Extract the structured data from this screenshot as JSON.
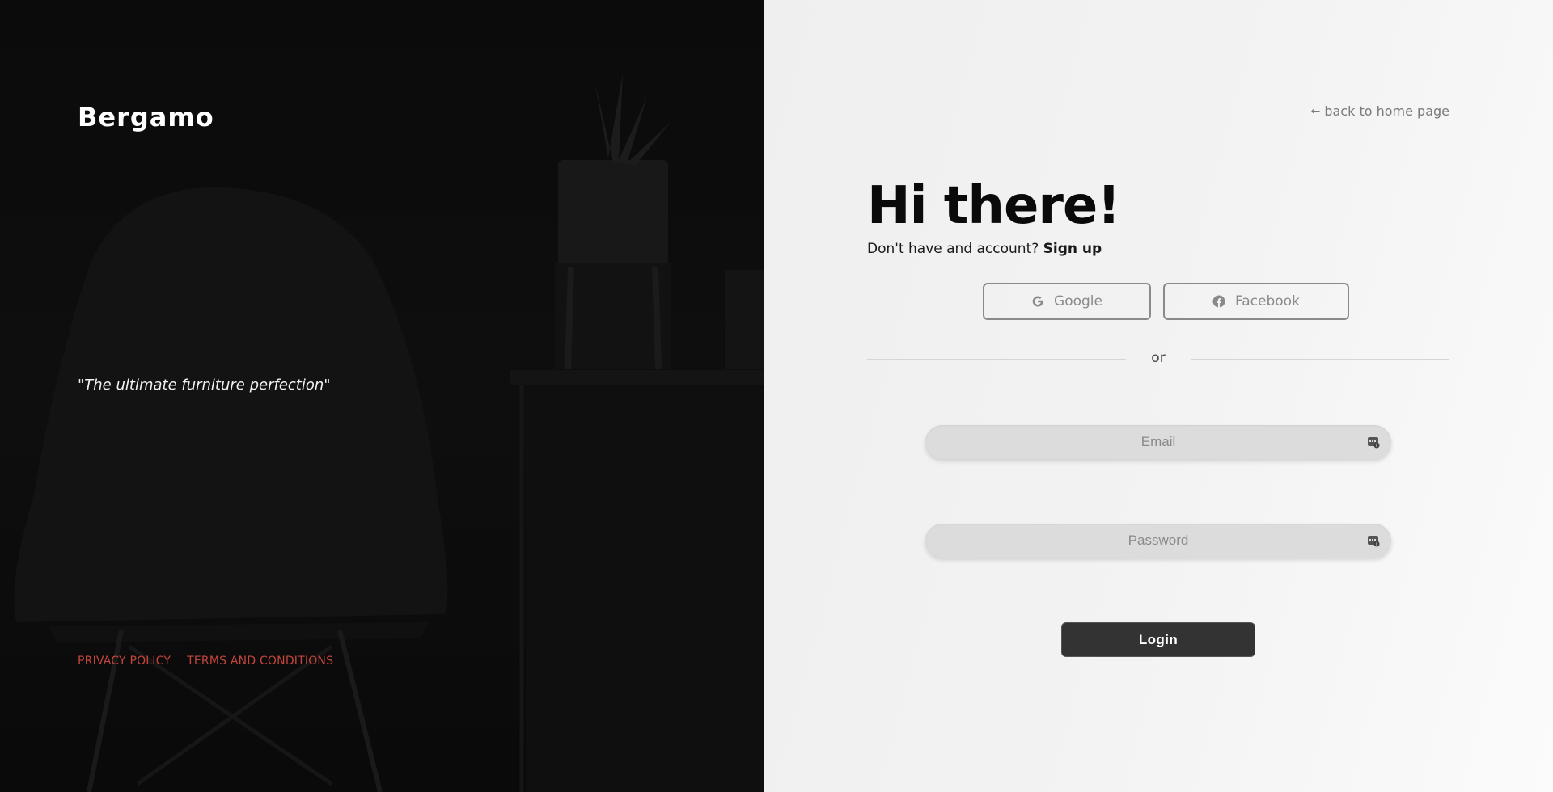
{
  "brand": {
    "name": "Bergamo"
  },
  "hero": {
    "tagline": "\"The ultimate furniture perfection\""
  },
  "footer": {
    "privacy_label": "PRIVACY POLICY",
    "terms_label": "TERMS AND CONDITIONS"
  },
  "nav": {
    "back_label": "back to home page",
    "back_icon": "arrow-left-icon"
  },
  "login": {
    "heading": "Hi there!",
    "signup_prompt": "Don't have and account?",
    "signup_link": "Sign up",
    "google_label": "Google",
    "facebook_label": "Facebook",
    "divider_text": "or",
    "email": {
      "value": "",
      "placeholder": "Email"
    },
    "password": {
      "value": "",
      "placeholder": "Password"
    },
    "submit_label": "Login"
  },
  "colors": {
    "left_bg": "#0b0b0b",
    "right_bg": "#f2f2f2",
    "footer_link": "#c4453c",
    "button_dark": "#333333"
  }
}
